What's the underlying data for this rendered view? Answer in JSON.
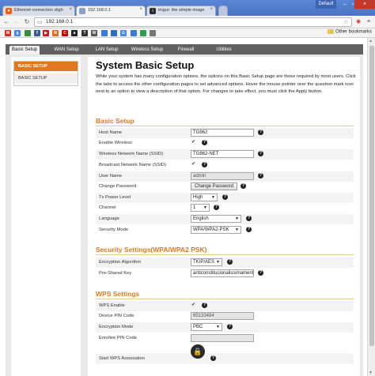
{
  "browser": {
    "tabs": [
      {
        "label": "Ethernet connection sligh",
        "icon": "reddit-icon",
        "active": false
      },
      {
        "label": "192.168.0.1",
        "icon": "page-icon",
        "active": true
      },
      {
        "label": "imgur: the simple image",
        "icon": "imgur-icon",
        "active": false
      }
    ],
    "profile_label": "Default",
    "address": "192.168.0.1",
    "other_bookmarks": "Other bookmarks",
    "bookmarks": [
      {
        "icon": "gmail-icon",
        "letter": "M",
        "color": "#d93025"
      },
      {
        "icon": "google-icon",
        "letter": "g",
        "color": "#4285f4"
      },
      {
        "icon": "flag-icon",
        "letter": "",
        "color": "#3b8e3b"
      },
      {
        "icon": "facebook-icon",
        "letter": "f",
        "color": "#3b5998"
      },
      {
        "icon": "youtube-icon",
        "letter": "▶",
        "color": "#cc181e"
      },
      {
        "icon": "news-icon",
        "letter": "N",
        "color": "#e46b1e"
      },
      {
        "icon": "cnn-icon",
        "letter": "C",
        "color": "#c00"
      },
      {
        "icon": "amazon-icon",
        "letter": "a",
        "color": "#222"
      },
      {
        "icon": "nyt-icon",
        "letter": "T",
        "color": "#333"
      },
      {
        "icon": "wiki-icon",
        "letter": "W",
        "color": "#555"
      },
      {
        "icon": "bookmark-icon",
        "letter": "",
        "color": "#3a7bd5"
      },
      {
        "icon": "bookmark-icon",
        "letter": "",
        "color": "#2c6fc0"
      },
      {
        "icon": "g-icon",
        "letter": "G",
        "color": "#4285f4"
      },
      {
        "icon": "bookmark-icon",
        "letter": "",
        "color": "#3a7bd5"
      },
      {
        "icon": "camera-icon",
        "letter": "",
        "color": "#2e9e4a"
      },
      {
        "icon": "drive-icon",
        "letter": "",
        "color": "#777"
      }
    ]
  },
  "router": {
    "nav_tabs": [
      "Basic Setup",
      "WAN Setup",
      "LAN Setup",
      "Wireless Setup",
      "Firewall",
      "Utilities"
    ],
    "sidebar": [
      "BASIC SETUP",
      "BASIC SETUP"
    ],
    "title": "System Basic Setup",
    "description": "While your system has many configuration options, the options on this Basic Setup page are those required by most users. Click the tabs to access the other configuration pages to set advanced options. Hover the mouse pointer over the question mark icon next to an option to view a description of that option. For changes to take effect, you must click the Apply button.",
    "sections": {
      "basic": "Basic Setup",
      "security": "Security Settings(WPA/WPA2 PSK)",
      "wps": "WPS Settings"
    },
    "fields": {
      "host_name": {
        "label": "Host Name",
        "value": "TG862"
      },
      "enable_wireless": {
        "label": "Enable Wireless",
        "checked": true
      },
      "ssid": {
        "label": "Wireless Network Name (SSID)",
        "value": "TG862-NET"
      },
      "broadcast_ssid": {
        "label": "Broadcast Network Name (SSID)",
        "checked": true
      },
      "user_name": {
        "label": "User Name",
        "value": "admin"
      },
      "change_password": {
        "label": "Change Password",
        "button": "Change Password"
      },
      "tx_power": {
        "label": "Tx Power Level",
        "value": "High"
      },
      "channel": {
        "label": "Channel",
        "value": "1"
      },
      "language": {
        "label": "Language",
        "value": "English"
      },
      "security_mode": {
        "label": "Security Mode",
        "value": "WPA/WPA2-PSK"
      },
      "encryption_algorithm": {
        "label": "Encryption Algorithm",
        "value": "TKIP/AES"
      },
      "pre_shared_key": {
        "label": "Pre-Shared Key",
        "value": "anticonstitucionalissimament"
      },
      "wps_enable": {
        "label": "WPS Enable",
        "checked": true
      },
      "device_pin": {
        "label": "Device PIN Code",
        "value": "65133484"
      },
      "encryption_mode": {
        "label": "Encryption Mode",
        "value": "PBC"
      },
      "enrollee_pin": {
        "label": "Enrollee PIN Code",
        "value": ""
      },
      "start_wps": {
        "label": "Start WPS Association"
      }
    },
    "accent_color": "#e0781f"
  }
}
